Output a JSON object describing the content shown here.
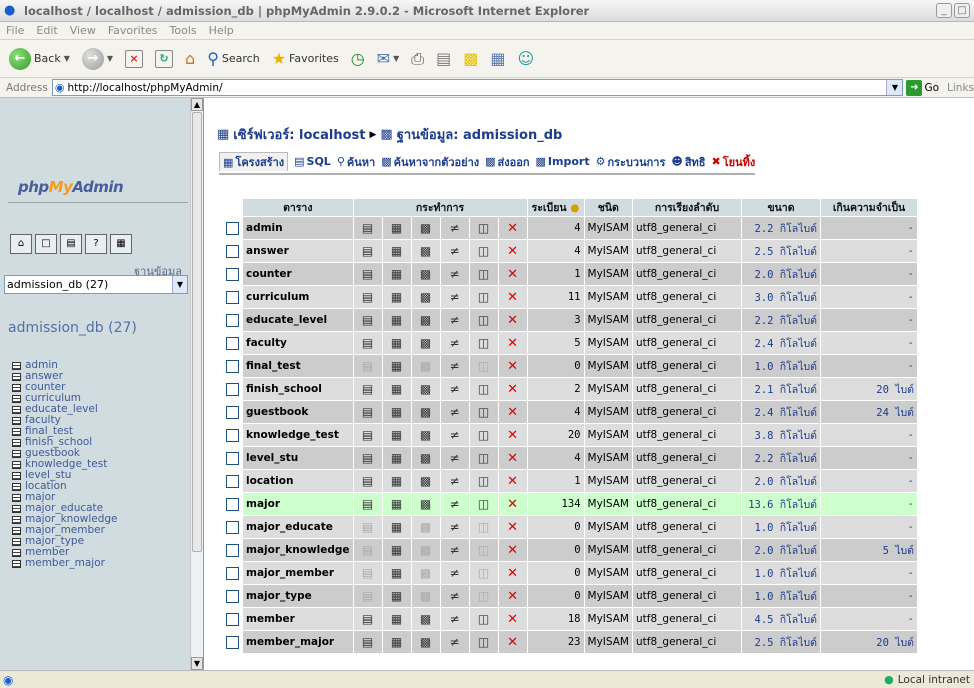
{
  "window": {
    "title": "localhost / localhost / admission_db | phpMyAdmin 2.9.0.2 - Microsoft Internet Explorer"
  },
  "menu": [
    "File",
    "Edit",
    "View",
    "Favorites",
    "Tools",
    "Help"
  ],
  "toolbar": {
    "back_label": "Back",
    "search_label": "Search",
    "favorites_label": "Favorites"
  },
  "address": {
    "label": "Address",
    "url": "http://localhost/phpMyAdmin/",
    "go_label": "Go",
    "links_label": "Links"
  },
  "sidebar": {
    "logo_pma": "php",
    "logo_my": "My",
    "logo_admin": "Admin",
    "db_label": "ฐานข้อมูล",
    "db_selected": "admission_db (27)",
    "db_heading": "admission_db (27)",
    "tables": [
      "admin",
      "answer",
      "counter",
      "curriculum",
      "educate_level",
      "faculty",
      "final_test",
      "finish_school",
      "guestbook",
      "knowledge_test",
      "level_stu",
      "location",
      "major",
      "major_educate",
      "major_knowledge",
      "major_member",
      "major_type",
      "member",
      "member_major"
    ]
  },
  "breadcrumb": {
    "server": "เซิร์ฟเวอร์: localhost",
    "database": "ฐานข้อมูล: admission_db"
  },
  "tabs": [
    "โครงสร้าง",
    "SQL",
    "ค้นหา",
    "ค้นหาจากตัวอย่าง",
    "ส่งออก",
    "Import",
    "กระบวนการ",
    "สิทธิ",
    "โยนทิ้ง"
  ],
  "table_headers": {
    "table": "ตาราง",
    "action": "กระทำการ",
    "records": "ระเบียน",
    "type": "ชนิด",
    "collation": "การเรียงลำดับ",
    "size": "ขนาด",
    "overhead": "เกินความจำเป็น"
  },
  "rows": [
    {
      "name": "admin",
      "records": "4",
      "type": "MyISAM",
      "collation": "utf8_general_ci",
      "size": "2.2 กิโลไบต์",
      "overhead": "-",
      "empty": false
    },
    {
      "name": "answer",
      "records": "4",
      "type": "MyISAM",
      "collation": "utf8_general_ci",
      "size": "2.5 กิโลไบต์",
      "overhead": "-",
      "empty": false
    },
    {
      "name": "counter",
      "records": "1",
      "type": "MyISAM",
      "collation": "utf8_general_ci",
      "size": "2.0 กิโลไบต์",
      "overhead": "-",
      "empty": false
    },
    {
      "name": "curriculum",
      "records": "11",
      "type": "MyISAM",
      "collation": "utf8_general_ci",
      "size": "3.0 กิโลไบต์",
      "overhead": "-",
      "empty": false
    },
    {
      "name": "educate_level",
      "records": "3",
      "type": "MyISAM",
      "collation": "utf8_general_ci",
      "size": "2.2 กิโลไบต์",
      "overhead": "-",
      "empty": false
    },
    {
      "name": "faculty",
      "records": "5",
      "type": "MyISAM",
      "collation": "utf8_general_ci",
      "size": "2.4 กิโลไบต์",
      "overhead": "-",
      "empty": false
    },
    {
      "name": "final_test",
      "records": "0",
      "type": "MyISAM",
      "collation": "utf8_general_ci",
      "size": "1.0 กิโลไบต์",
      "overhead": "-",
      "empty": true
    },
    {
      "name": "finish_school",
      "records": "2",
      "type": "MyISAM",
      "collation": "utf8_general_ci",
      "size": "2.1 กิโลไบต์",
      "overhead": "20 ไบต์",
      "empty": false
    },
    {
      "name": "guestbook",
      "records": "4",
      "type": "MyISAM",
      "collation": "utf8_general_ci",
      "size": "2.4 กิโลไบต์",
      "overhead": "24 ไบต์",
      "empty": false
    },
    {
      "name": "knowledge_test",
      "records": "20",
      "type": "MyISAM",
      "collation": "utf8_general_ci",
      "size": "3.8 กิโลไบต์",
      "overhead": "-",
      "empty": false
    },
    {
      "name": "level_stu",
      "records": "4",
      "type": "MyISAM",
      "collation": "utf8_general_ci",
      "size": "2.2 กิโลไบต์",
      "overhead": "-",
      "empty": false
    },
    {
      "name": "location",
      "records": "1",
      "type": "MyISAM",
      "collation": "utf8_general_ci",
      "size": "2.0 กิโลไบต์",
      "overhead": "-",
      "empty": false
    },
    {
      "name": "major",
      "records": "134",
      "type": "MyISAM",
      "collation": "utf8_general_ci",
      "size": "13.6 กิโลไบต์",
      "overhead": "-",
      "empty": false,
      "highlight": true
    },
    {
      "name": "major_educate",
      "records": "0",
      "type": "MyISAM",
      "collation": "utf8_general_ci",
      "size": "1.0 กิโลไบต์",
      "overhead": "-",
      "empty": true
    },
    {
      "name": "major_knowledge",
      "records": "0",
      "type": "MyISAM",
      "collation": "utf8_general_ci",
      "size": "2.0 กิโลไบต์",
      "overhead": "5 ไบต์",
      "empty": true
    },
    {
      "name": "major_member",
      "records": "0",
      "type": "MyISAM",
      "collation": "utf8_general_ci",
      "size": "1.0 กิโลไบต์",
      "overhead": "-",
      "empty": true
    },
    {
      "name": "major_type",
      "records": "0",
      "type": "MyISAM",
      "collation": "utf8_general_ci",
      "size": "1.0 กิโลไบต์",
      "overhead": "-",
      "empty": true
    },
    {
      "name": "member",
      "records": "18",
      "type": "MyISAM",
      "collation": "utf8_general_ci",
      "size": "4.5 กิโลไบต์",
      "overhead": "-",
      "empty": false
    },
    {
      "name": "member_major",
      "records": "23",
      "type": "MyISAM",
      "collation": "utf8_general_ci",
      "size": "2.5 กิโลไบต์",
      "overhead": "20 ไบต์",
      "empty": false
    }
  ],
  "status": {
    "zone": "Local intranet"
  },
  "colors": {
    "odd_row": "#cccccc",
    "even_row": "#dddddd",
    "highlight_row": "#ccffcc",
    "sidebar_bg": "#d0dce0",
    "link": "#1c3c8c"
  }
}
